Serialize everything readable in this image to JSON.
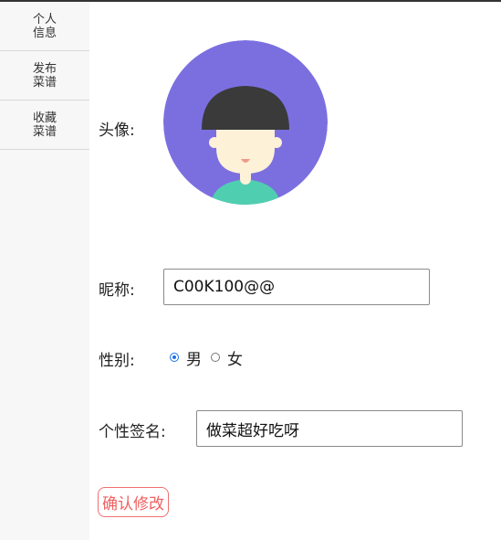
{
  "sidebar": {
    "items": [
      {
        "label": "个人信息"
      },
      {
        "label": "发布菜谱"
      },
      {
        "label": "收藏菜谱"
      }
    ]
  },
  "form": {
    "avatar_label": "头像:",
    "nickname_label": "昵称:",
    "nickname_value": "C00K100@@",
    "gender_label": "性别:",
    "gender_options": [
      {
        "label": "男",
        "checked": true
      },
      {
        "label": "女",
        "checked": false
      }
    ],
    "signature_label": "个性签名:",
    "signature_value": "做菜超好吃呀",
    "confirm_label": "确认修改"
  },
  "colors": {
    "avatar_bg": "#7b6fe0",
    "accent_red": "#f06060",
    "radio_blue": "#1a73e8"
  }
}
